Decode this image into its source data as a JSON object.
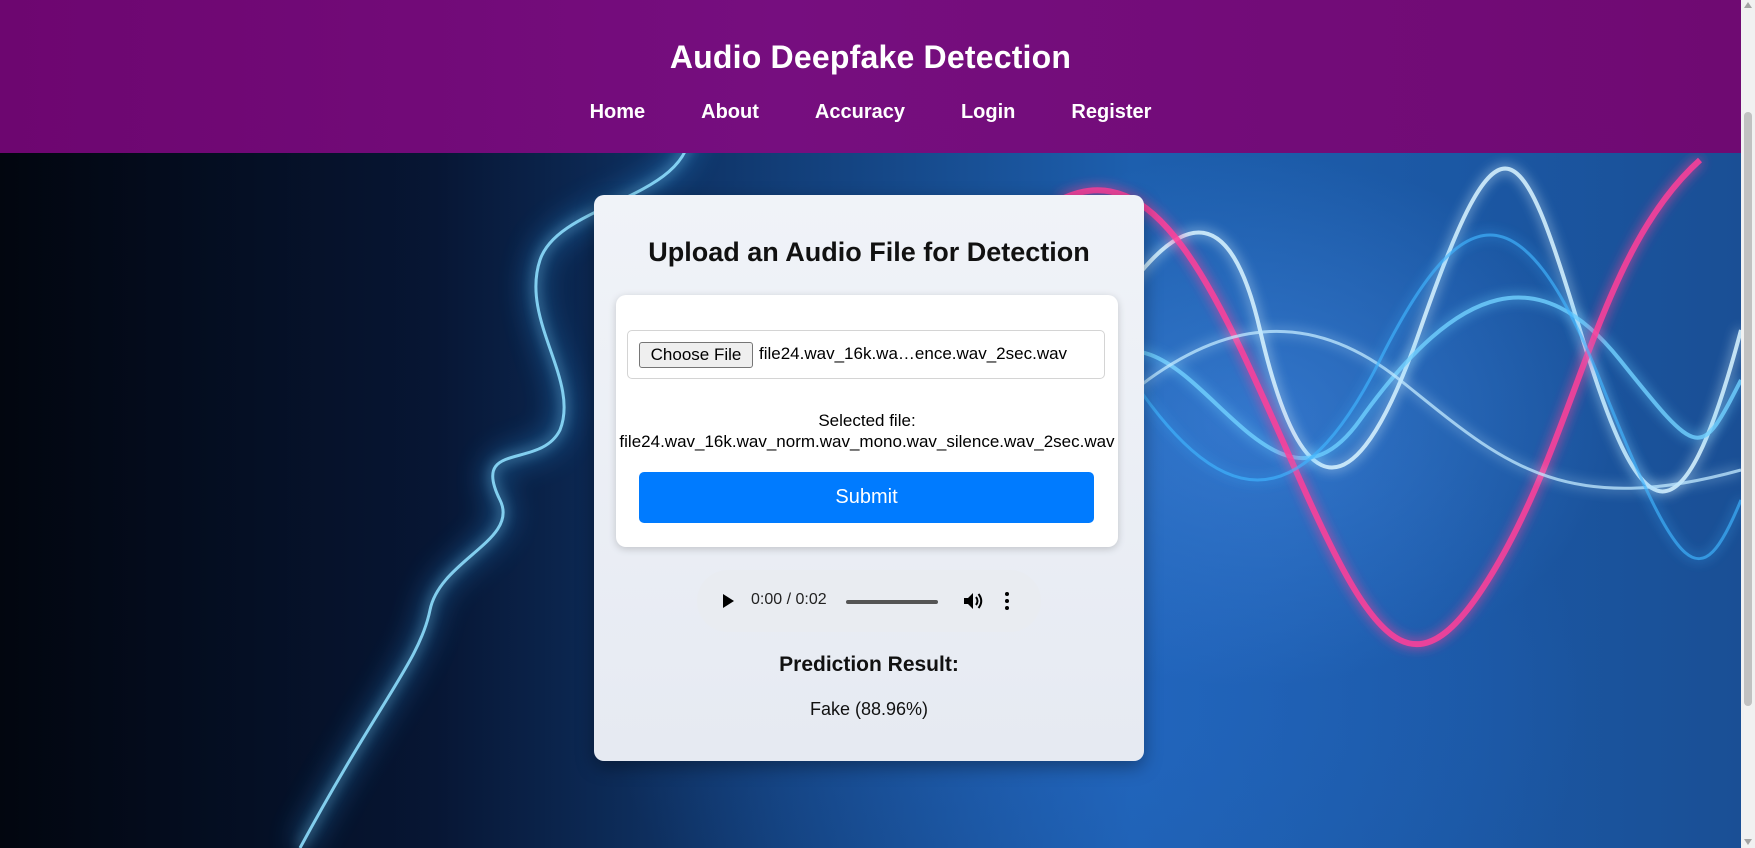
{
  "header": {
    "title": "Audio Deepfake Detection",
    "nav": [
      "Home",
      "About",
      "Accuracy",
      "Login",
      "Register"
    ]
  },
  "card": {
    "title": "Upload an Audio File for Detection",
    "file_input": {
      "button_label": "Choose File",
      "displayed_name": "file24.wav_16k.wa…ence.wav_2sec.wav"
    },
    "selected_file_label": "Selected file:",
    "selected_file_name": "file24.wav_16k.wav_norm.wav_mono.wav_silence.wav_2sec.wav",
    "submit_label": "Submit",
    "audio_player": {
      "time": "0:00 / 0:02",
      "play_icon": "play-icon",
      "volume_icon": "volume-icon",
      "menu_icon": "more-vertical-icon"
    },
    "result_title": "Prediction Result:",
    "result_value": "Fake (88.96%)"
  },
  "colors": {
    "header": "#720a77",
    "submit": "#007bff",
    "card": "#eceff5"
  }
}
